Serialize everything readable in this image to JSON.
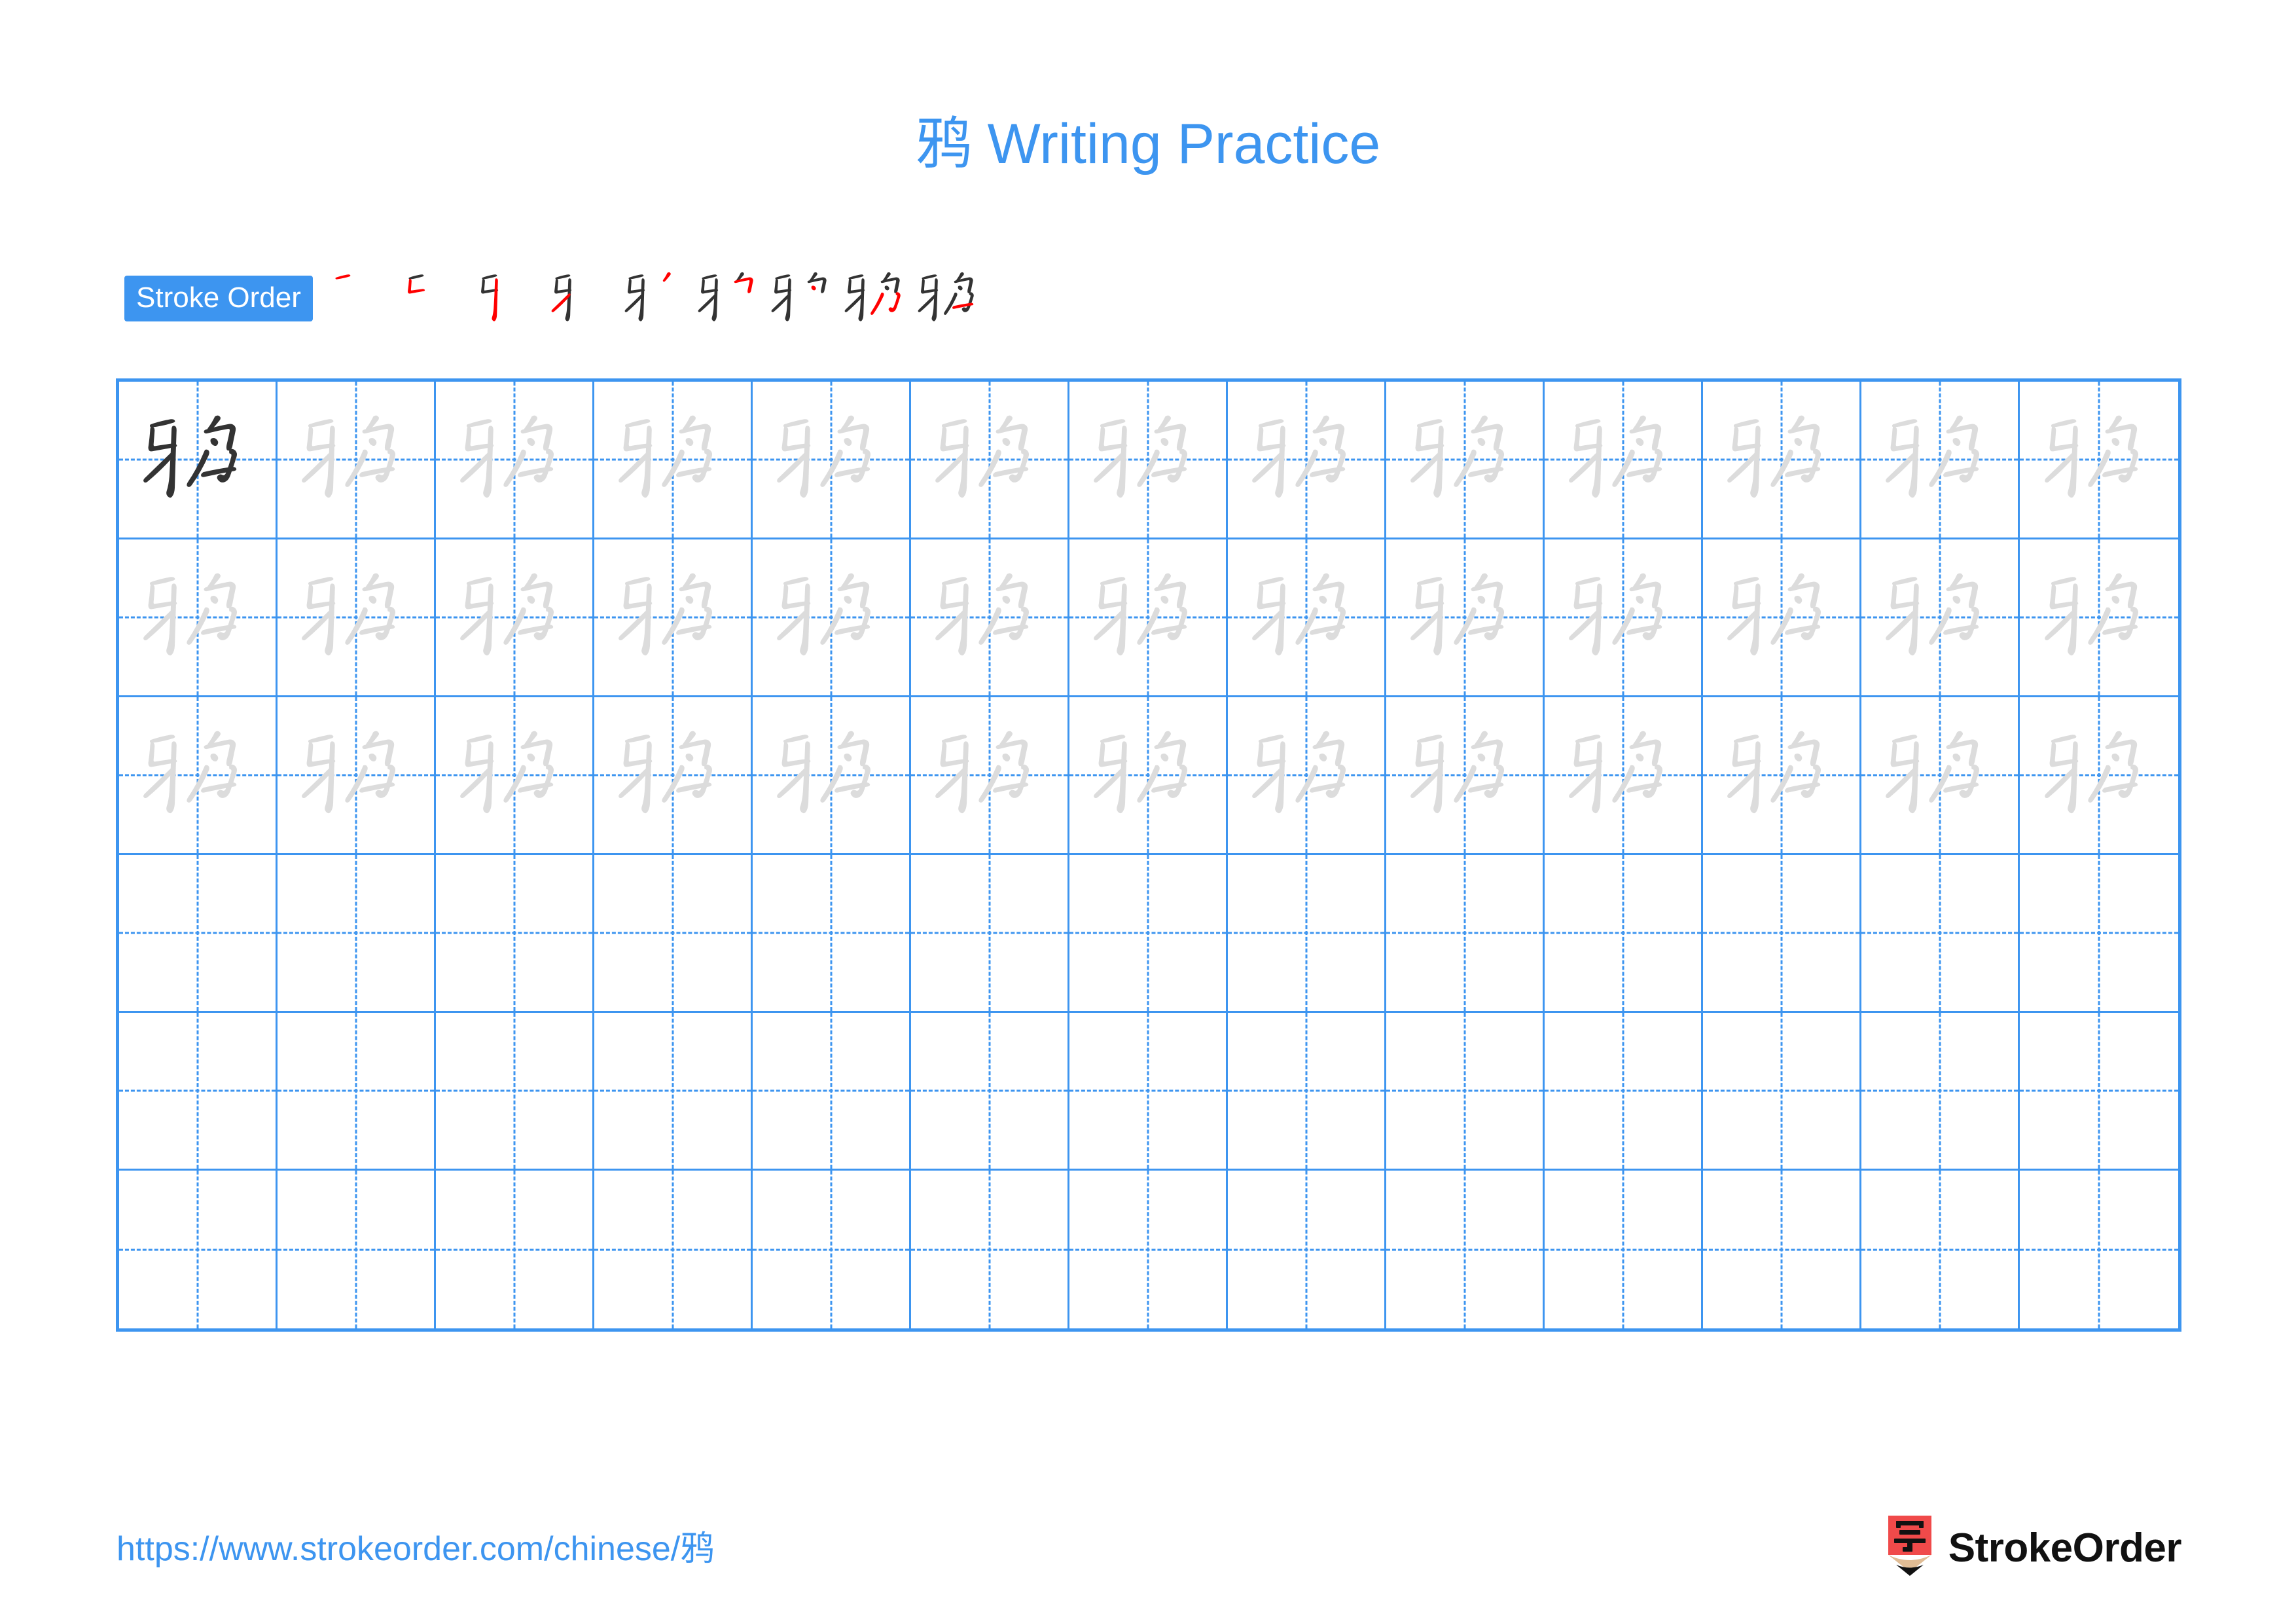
{
  "page": {
    "character": "鸦",
    "title": "鸦 Writing Practice",
    "background_color": "#ffffff"
  },
  "stroke_order": {
    "badge_label": "Stroke Order",
    "badge_bg_color": "#3d95f0",
    "badge_text_color": "#ffffff",
    "existing_stroke_color": "#333333",
    "new_stroke_color": "#ff0000",
    "total_strokes": 9,
    "steps": [
      {
        "index": 1,
        "strokes_shown": 1,
        "new_stroke": 1
      },
      {
        "index": 2,
        "strokes_shown": 2,
        "new_stroke": 2
      },
      {
        "index": 3,
        "strokes_shown": 3,
        "new_stroke": 3
      },
      {
        "index": 4,
        "strokes_shown": 4,
        "new_stroke": 4
      },
      {
        "index": 5,
        "strokes_shown": 5,
        "new_stroke": 5
      },
      {
        "index": 6,
        "strokes_shown": 6,
        "new_stroke": 6
      },
      {
        "index": 7,
        "strokes_shown": 7,
        "new_stroke": 7
      },
      {
        "index": 8,
        "strokes_shown": 8,
        "new_stroke": 8
      },
      {
        "index": 9,
        "strokes_shown": 9,
        "new_stroke": 9
      }
    ]
  },
  "practice_grid": {
    "columns": 13,
    "rows": 6,
    "grid_line_color": "#3d95f0",
    "model_char_color": "#333333",
    "trace_char_color": "#dcdcdc",
    "cells": [
      [
        "model",
        "trace",
        "trace",
        "trace",
        "trace",
        "trace",
        "trace",
        "trace",
        "trace",
        "trace",
        "trace",
        "trace",
        "trace"
      ],
      [
        "trace",
        "trace",
        "trace",
        "trace",
        "trace",
        "trace",
        "trace",
        "trace",
        "trace",
        "trace",
        "trace",
        "trace",
        "trace"
      ],
      [
        "trace",
        "trace",
        "trace",
        "trace",
        "trace",
        "trace",
        "trace",
        "trace",
        "trace",
        "trace",
        "trace",
        "trace",
        "trace"
      ],
      [
        "empty",
        "empty",
        "empty",
        "empty",
        "empty",
        "empty",
        "empty",
        "empty",
        "empty",
        "empty",
        "empty",
        "empty",
        "empty"
      ],
      [
        "empty",
        "empty",
        "empty",
        "empty",
        "empty",
        "empty",
        "empty",
        "empty",
        "empty",
        "empty",
        "empty",
        "empty",
        "empty"
      ],
      [
        "empty",
        "empty",
        "empty",
        "empty",
        "empty",
        "empty",
        "empty",
        "empty",
        "empty",
        "empty",
        "empty",
        "empty",
        "empty"
      ]
    ]
  },
  "footer": {
    "url": "https://www.strokeorder.com/chinese/鸦",
    "url_color": "#3d95f0",
    "brand_name": "StrokeOrder",
    "logo_char": "字",
    "logo_body_color": "#f04a4a",
    "logo_wood_color": "#e0bc94",
    "logo_tip_color": "#111111"
  }
}
